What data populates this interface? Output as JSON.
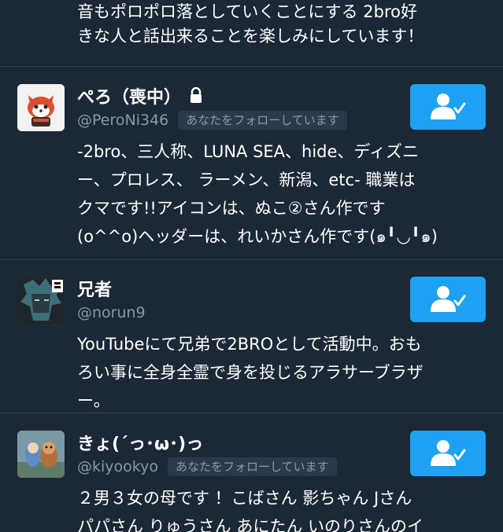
{
  "top_bio": "音もポロポロ落としていくことにする 2bro好\nきな人と話出来ることを楽しみにしています！",
  "users": [
    {
      "display_name": "ぺろ（喪中）",
      "handle": "@PeroNi346",
      "follows_you": "あなたをフォローしています",
      "bio": "-2bro、三人称、LUNA SEA、hide、ディズニ\nー、プロレス、 ラーメン、新潟、etc- 職業は\nクマです!!アイコンは、ぬこ②さん作です\n(o^^o)ヘッダーは、れいかさん作です(๑╹◡╹๑)",
      "protected": true,
      "button_icon": "following-user-icon"
    },
    {
      "display_name": "兄者",
      "handle": "@norun9",
      "follows_you": "",
      "bio": "YouTubeにて兄弟で2BROとして活動中。おも\nろい事に全身全霊で身を投じるアラサーブラザ\nー。",
      "protected": false,
      "button_icon": "following-user-icon"
    },
    {
      "display_name": "きょ(´っ･ω･)っ",
      "handle": "@kiyookyo",
      "follows_you": "あなたをフォローしています",
      "bio": "２男３女の母です ！こばさん 影ちゃん Jさん\nパパさん りゅうさん あにたん いのりさんのイ",
      "protected": false,
      "button_icon": "following-user-icon"
    }
  ],
  "colors": {
    "background": "#1b2836",
    "accent": "#1da1f2",
    "secondary_text": "#8899a6",
    "divider": "#37444f"
  }
}
